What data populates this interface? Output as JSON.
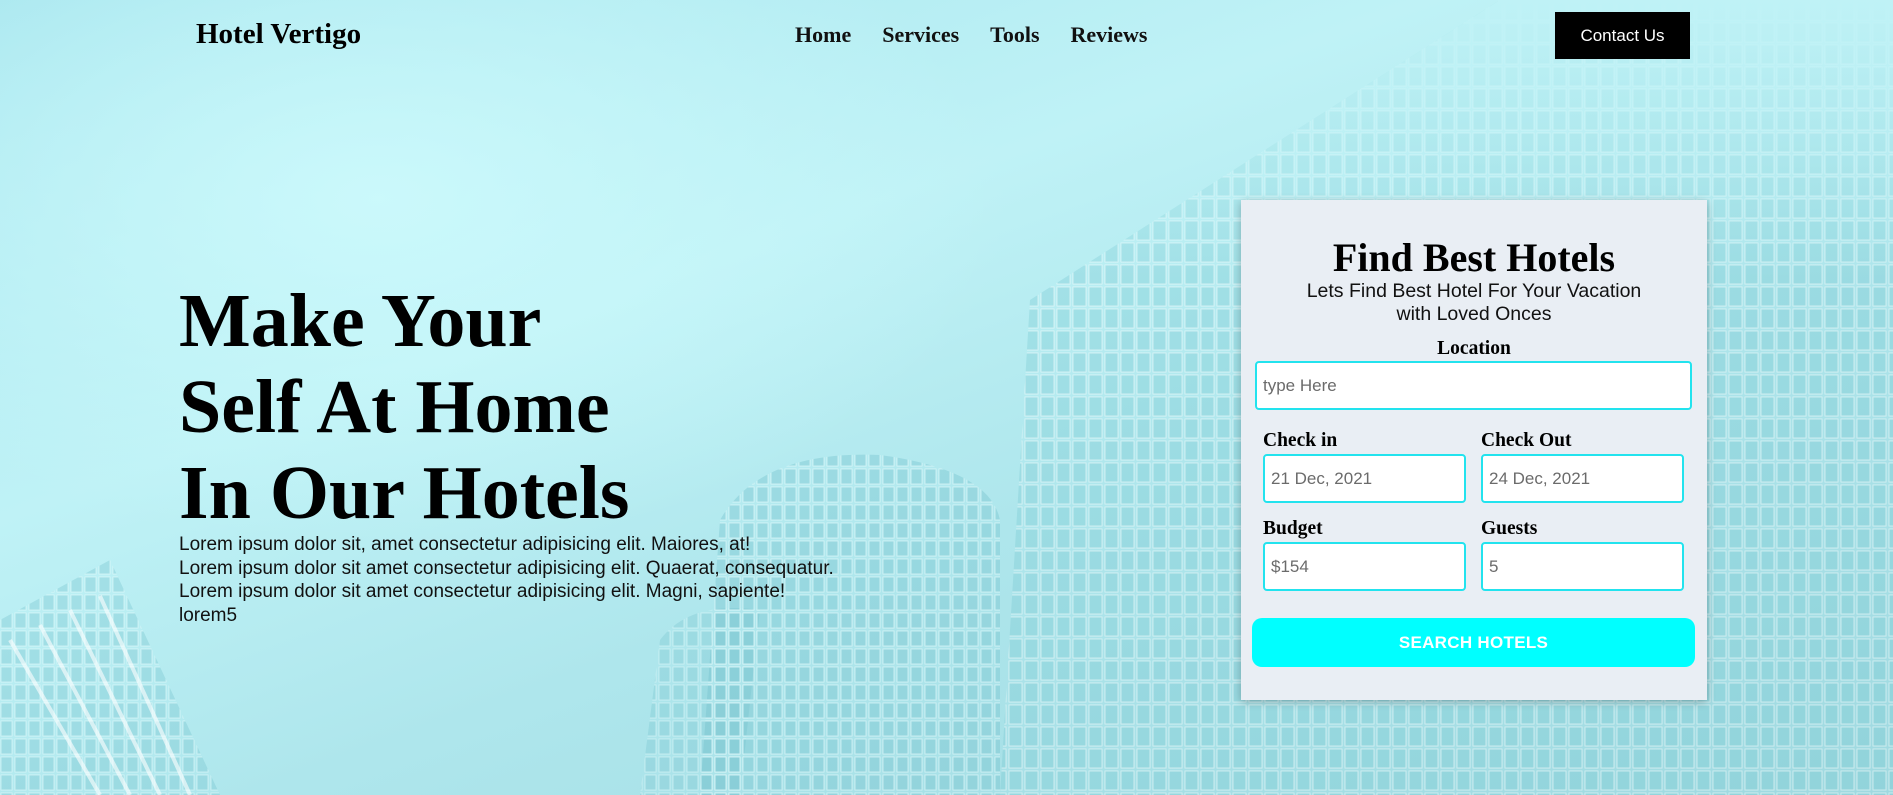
{
  "nav": {
    "brand": "Hotel Vertigo",
    "links": [
      "Home",
      "Services",
      "Tools",
      "Reviews"
    ],
    "contact_label": "Contact Us"
  },
  "hero": {
    "headline": [
      "Make Your",
      "Self At Home",
      "In Our Hotels"
    ],
    "body": [
      "Lorem ipsum dolor sit, amet consectetur adipisicing elit. Maiores, at!",
      "Lorem ipsum dolor sit amet consectetur adipisicing elit. Quaerat, consequatur.",
      "Lorem ipsum dolor sit amet consectetur adipisicing elit. Magni, sapiente!",
      "lorem5"
    ]
  },
  "search_card": {
    "title": "Find Best Hotels",
    "subtitle_lines": [
      "Lets Find Best Hotel For Your Vacation",
      "with Loved Onces"
    ],
    "location": {
      "label": "Location",
      "placeholder": "type Here"
    },
    "check_in": {
      "label": "Check in",
      "placeholder": "21 Dec, 2021"
    },
    "check_out": {
      "label": "Check Out",
      "placeholder": "24 Dec, 2021"
    },
    "budget": {
      "label": "Budget",
      "placeholder": "$154"
    },
    "guests": {
      "label": "Guests",
      "placeholder": "5"
    },
    "search_label": "SEARCH HOTELS"
  },
  "colors": {
    "accent": "#00ffff",
    "field_border": "#22e3ee",
    "card_bg": "#e9eef4",
    "contact_bg": "#000000"
  }
}
